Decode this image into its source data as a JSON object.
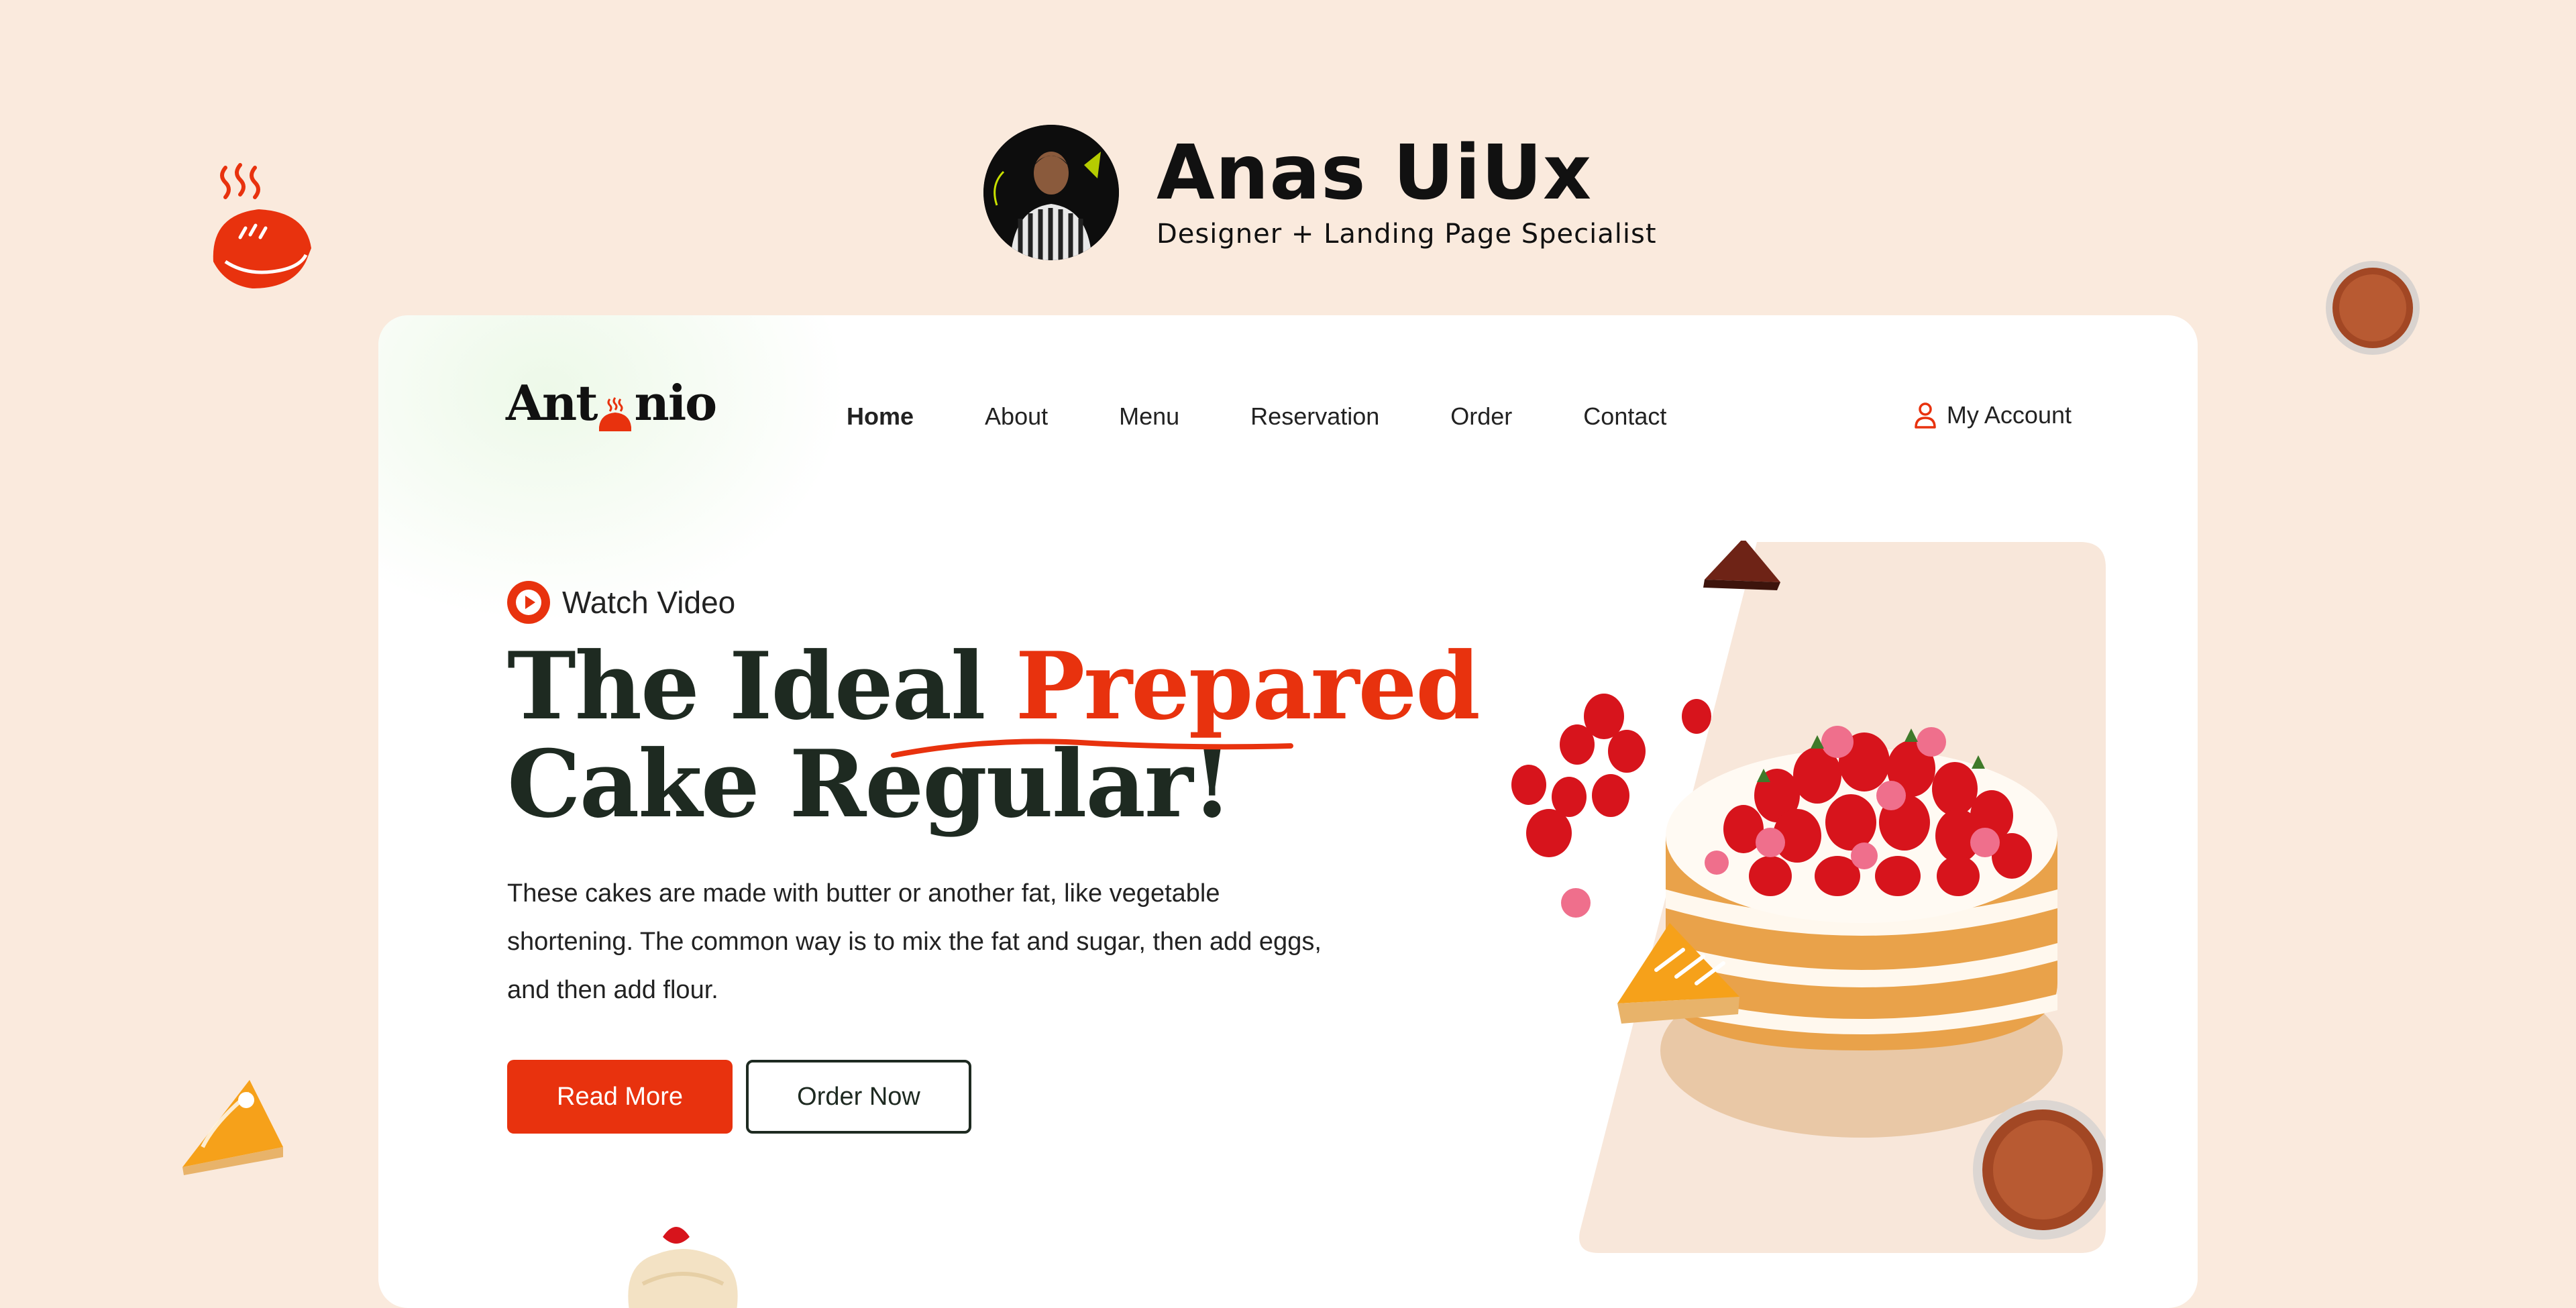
{
  "designer": {
    "name": "Anas UiUx",
    "role": "Designer + Landing Page Specialist"
  },
  "site": {
    "logo_text_left": "Ant",
    "logo_text_right": "nio",
    "nav": [
      {
        "label": "Home",
        "active": true
      },
      {
        "label": "About",
        "active": false
      },
      {
        "label": "Menu",
        "active": false
      },
      {
        "label": "Reservation",
        "active": false
      },
      {
        "label": "Order",
        "active": false
      },
      {
        "label": "Contact",
        "active": false
      }
    ],
    "account_label": "My Account"
  },
  "hero": {
    "watch_label": "Watch Video",
    "headline_line1_part1": "The Ideal ",
    "headline_line1_accent": "Prepared",
    "headline_line2": "Cake Regular!",
    "description": "These cakes are made with butter or another fat, like vegetable shortening. The common way is to mix the fat and sugar, then add eggs, and then add flour.",
    "primary_button": "Read More",
    "secondary_button": "Order Now"
  },
  "colors": {
    "page_bg": "#FAEADD",
    "accent": "#E8320E",
    "heading": "#1E2A21",
    "panel": "#F8E7DA"
  },
  "icons": {
    "play": "play-circle-icon",
    "account": "user-icon",
    "logo_mark": "hot-pie-icon"
  }
}
